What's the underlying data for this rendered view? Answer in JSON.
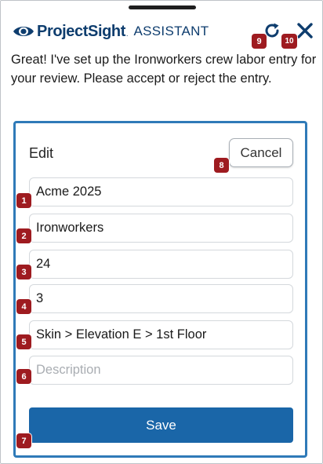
{
  "header": {
    "brand": "ProjectSight",
    "brand_mark": ".",
    "subtitle": "ASSISTANT"
  },
  "message": "Great! I've set up the Ironworkers crew labor entry for your review. Please accept or reject the entry.",
  "form": {
    "title": "Edit",
    "cancel_label": "Cancel",
    "save_label": "Save",
    "fields": [
      {
        "value": "Acme 2025",
        "placeholder": ""
      },
      {
        "value": "Ironworkers",
        "placeholder": ""
      },
      {
        "value": "24",
        "placeholder": ""
      },
      {
        "value": "3",
        "placeholder": ""
      },
      {
        "value": "Skin > Elevation E > 1st Floor",
        "placeholder": ""
      },
      {
        "value": "",
        "placeholder": "Description"
      }
    ]
  },
  "badges": {
    "b1": "1",
    "b2": "2",
    "b3": "3",
    "b4": "4",
    "b5": "5",
    "b6": "6",
    "b7": "7",
    "b8": "8",
    "b9": "9",
    "b10": "10"
  },
  "icons": {
    "logo": "eye-logo-icon",
    "refresh": "refresh-icon",
    "close": "close-icon"
  },
  "colors": {
    "brand": "#0e3d6e",
    "accent": "#2f7ab8",
    "primary_button": "#1a66a8",
    "badge": "#9e1b20"
  }
}
